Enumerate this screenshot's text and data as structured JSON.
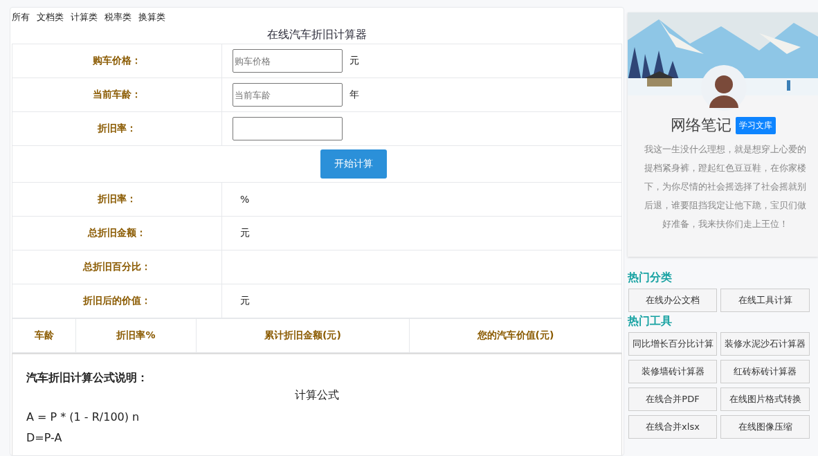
{
  "nav": [
    "所有",
    "文档类",
    "计算类",
    "税率类",
    "换算类"
  ],
  "title": "在线汽车折旧计算器",
  "inputs": [
    {
      "label": "购车价格：",
      "placeholder": "购车价格",
      "unit": "元"
    },
    {
      "label": "当前车龄：",
      "placeholder": "当前车龄",
      "unit": "年"
    },
    {
      "label": "折旧率："
    }
  ],
  "calculate_button": "开始计算",
  "results": [
    {
      "label": "折旧率：",
      "value": "%"
    },
    {
      "label": "总折旧金额：",
      "value": "元"
    },
    {
      "label": "总折旧百分比："
    },
    {
      "label": "折旧后的价值：",
      "value": "元"
    }
  ],
  "schedule_columns": [
    "车龄",
    "折旧率%",
    "累计折旧金额(元)",
    "您的汽车价值(元)"
  ],
  "formula": {
    "heading": "汽车折旧计算公式说明：",
    "subtitle": "计算公式",
    "lines": [
      "A = P * (1 - R/100) n",
      "D=P-A"
    ]
  },
  "profile": {
    "name": "网络笔记",
    "badge": "学习文库",
    "motto": "我这一生没什么理想，就是想穿上心爱的提档紧身裤，蹬起红色豆豆鞋，在你家楼下，为你尽情的社会摇选择了社会摇就别后退，谁要阻挡我定让他下跪，宝贝们做好准备，我来扶你们走上王位！"
  },
  "sections": [
    {
      "title": "热门分类",
      "links": [
        "在线办公文档",
        "在线工具计算"
      ]
    },
    {
      "title": "热门工具",
      "links": [
        "同比增长百分比计算",
        "装修水泥沙石计算器",
        "装修墙砖计算器",
        "红砖标砖计算器",
        "在线合并PDF",
        "在线图片格式转换",
        "在线合并xlsx",
        "在线图像压缩"
      ]
    }
  ]
}
